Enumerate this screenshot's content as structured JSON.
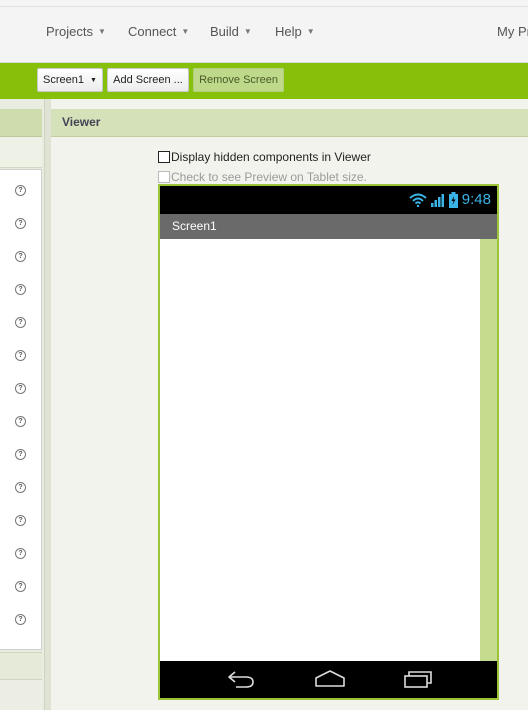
{
  "topbar": {
    "menus": [
      {
        "label": "Projects"
      },
      {
        "label": "Connect"
      },
      {
        "label": "Build"
      },
      {
        "label": "Help"
      }
    ],
    "user_label": "My Pr"
  },
  "toolbar": {
    "screen_select": "Screen1",
    "add_screen": "Add Screen ...",
    "remove_screen": "Remove Screen"
  },
  "viewer": {
    "title": "Viewer",
    "display_hidden_label": "Display hidden components in Viewer",
    "display_hidden_checked": false,
    "tablet_preview_label": "Check to see Preview on Tablet size.",
    "tablet_preview_checked": false
  },
  "phone": {
    "time": "9:48",
    "screen_title": "Screen1"
  },
  "palette": {
    "help_icon_glyph": "?",
    "help_icon_count": 14
  },
  "colors": {
    "accent_green": "#87c00a",
    "viewer_header": "#d5e1b8",
    "status_blue": "#3ab4e6"
  }
}
